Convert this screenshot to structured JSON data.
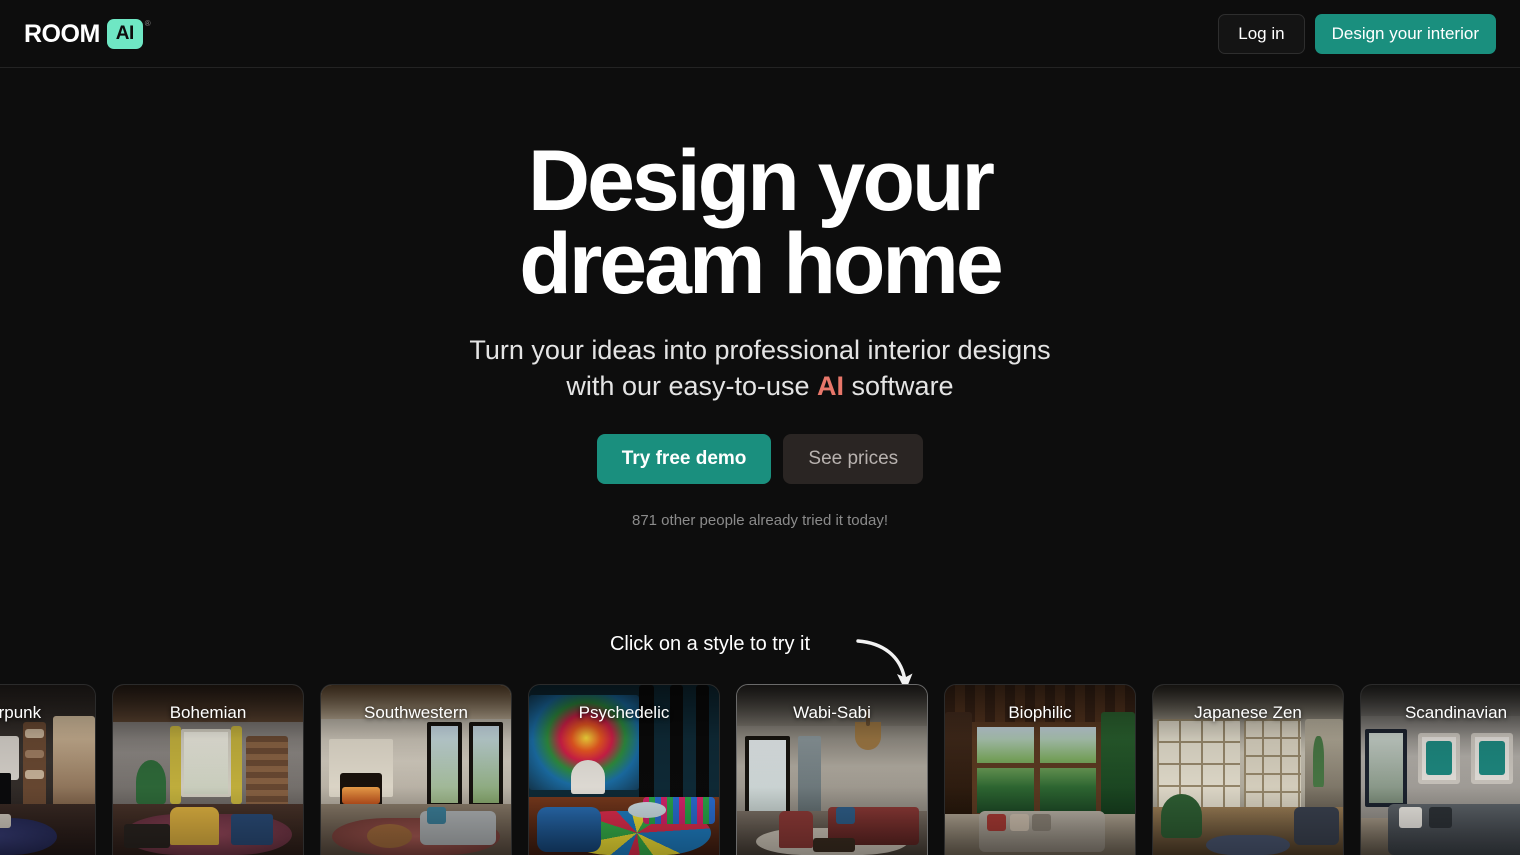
{
  "header": {
    "logo": {
      "word": "ROOM",
      "badge": "AI",
      "registered": "®"
    },
    "login_label": "Log in",
    "cta_label": "Design your interior"
  },
  "hero": {
    "title_line1": "Design your",
    "title_line2": "dream home",
    "sub_pre": "Turn your ideas into professional interior designs with our easy-to-use ",
    "sub_accent": "AI",
    "sub_post": " software",
    "primary_cta": "Try free demo",
    "secondary_cta": "See prices",
    "social_proof": "871 other people already tried it today!"
  },
  "picker": {
    "hint": "Click on a style to try it",
    "arrow_icon": "curved-arrow-down-right-icon",
    "cards": [
      {
        "label": "Cyberpunk",
        "partial": true,
        "active": false
      },
      {
        "label": "Bohemian",
        "partial": false,
        "active": false
      },
      {
        "label": "Southwestern",
        "partial": false,
        "active": false
      },
      {
        "label": "Psychedelic",
        "partial": false,
        "active": false
      },
      {
        "label": "Wabi-Sabi",
        "partial": false,
        "active": true
      },
      {
        "label": "Biophilic",
        "partial": false,
        "active": false
      },
      {
        "label": "Japanese Zen",
        "partial": false,
        "active": false
      },
      {
        "label": "Scandinavian",
        "partial": true,
        "active": false
      }
    ]
  },
  "colors": {
    "background": "#0d0d0d",
    "accent_teal": "#1a8f7e",
    "accent_mint": "#6fe7c4",
    "accent_coral": "#e8776a",
    "muted_text": "#8b8b8b"
  }
}
